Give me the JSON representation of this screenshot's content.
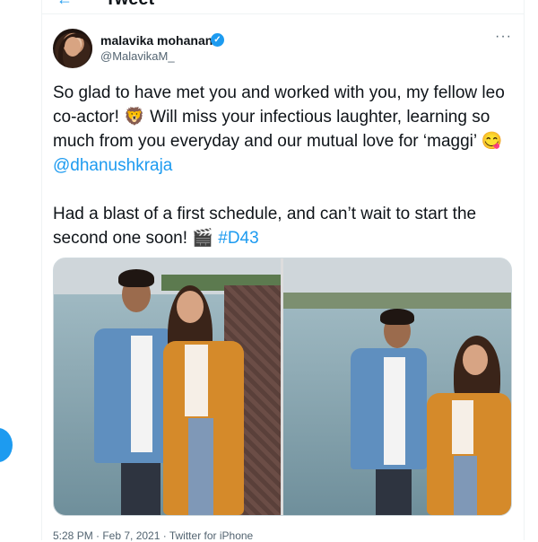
{
  "header": {
    "title": "Tweet"
  },
  "tweet": {
    "author": {
      "display_name": "malavika mohanan",
      "handle": "@MalavikaM_"
    },
    "text": {
      "p1_part1": "So glad to have met you and worked with you, my fellow leo co-actor! ",
      "p1_emoji1": "🦁",
      "p1_part2": " Will miss your infectious laughter, learning so much from you everyday and our mutual love for ‘maggi’ ",
      "p1_emoji2": "😋",
      "p1_mention": " @dhanushkraja",
      "p2_part1": "Had a blast of a first schedule, and can’t wait to start the second one soon! ",
      "p2_emoji": "🎬",
      "p2_hashtag": " #D43"
    },
    "meta": "5:28 PM · Feb 7, 2021 · Twitter for iPhone"
  },
  "colors": {
    "accent": "#1d9bf0",
    "text": "#0f1419",
    "secondary": "#536471",
    "border": "#cfd9de"
  },
  "icons": {
    "back": "back-arrow-icon",
    "verified": "verified-badge-icon",
    "more": "more-options-icon"
  }
}
